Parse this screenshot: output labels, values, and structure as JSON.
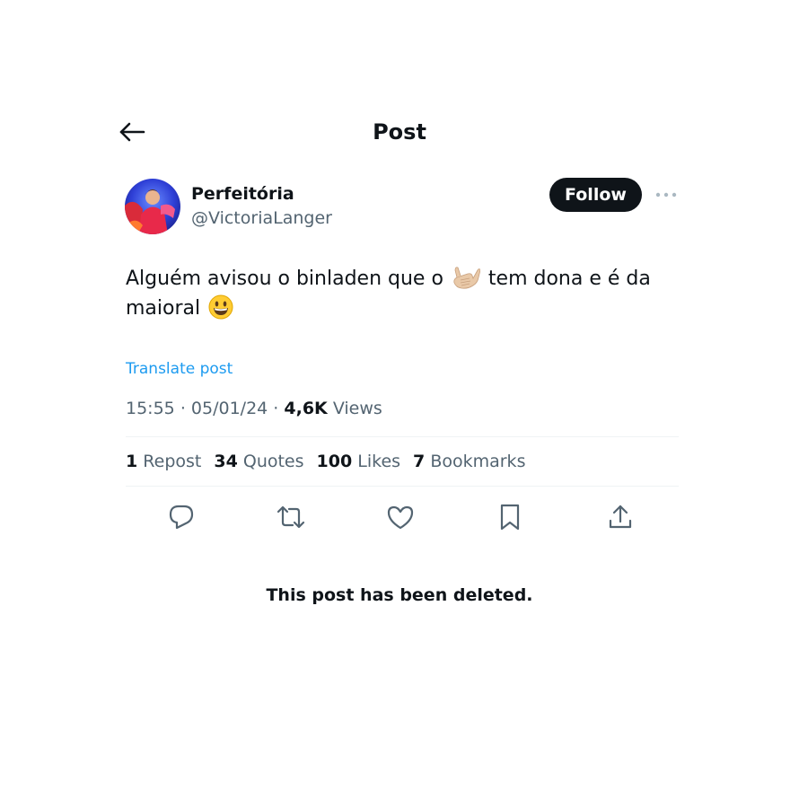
{
  "header": {
    "title": "Post",
    "back_icon": "arrow-left-icon"
  },
  "author": {
    "display_name": "Perfeitória",
    "handle": "@VictoriaLanger"
  },
  "follow_label": "Follow",
  "more_icon": "more-horizontal-icon",
  "tweet": {
    "text_part1": "Alguém avisou o binladen que o",
    "emoji1": "call-me-hand-emoji",
    "text_part2": "tem dona e é da",
    "text_part3": "maioral",
    "emoji2": "smiling-face-emoji"
  },
  "translate_label": "Translate post",
  "meta": {
    "time": "15:55",
    "date": "05/01/24",
    "views_count": "4,6K",
    "views_label": "Views",
    "separator": "·"
  },
  "stats": [
    {
      "count": "1",
      "label": "Repost"
    },
    {
      "count": "34",
      "label": "Quotes"
    },
    {
      "count": "100",
      "label": "Likes"
    },
    {
      "count": "7",
      "label": "Bookmarks"
    }
  ],
  "actions": [
    "reply-icon",
    "repost-icon",
    "like-icon",
    "bookmark-icon",
    "share-icon"
  ],
  "deleted_notice": "This post has been deleted.",
  "colors": {
    "text": "#0f1419",
    "secondary": "#536471",
    "link": "#1d9bf0",
    "divider": "#eff3f4",
    "button_bg": "#0f1419"
  }
}
